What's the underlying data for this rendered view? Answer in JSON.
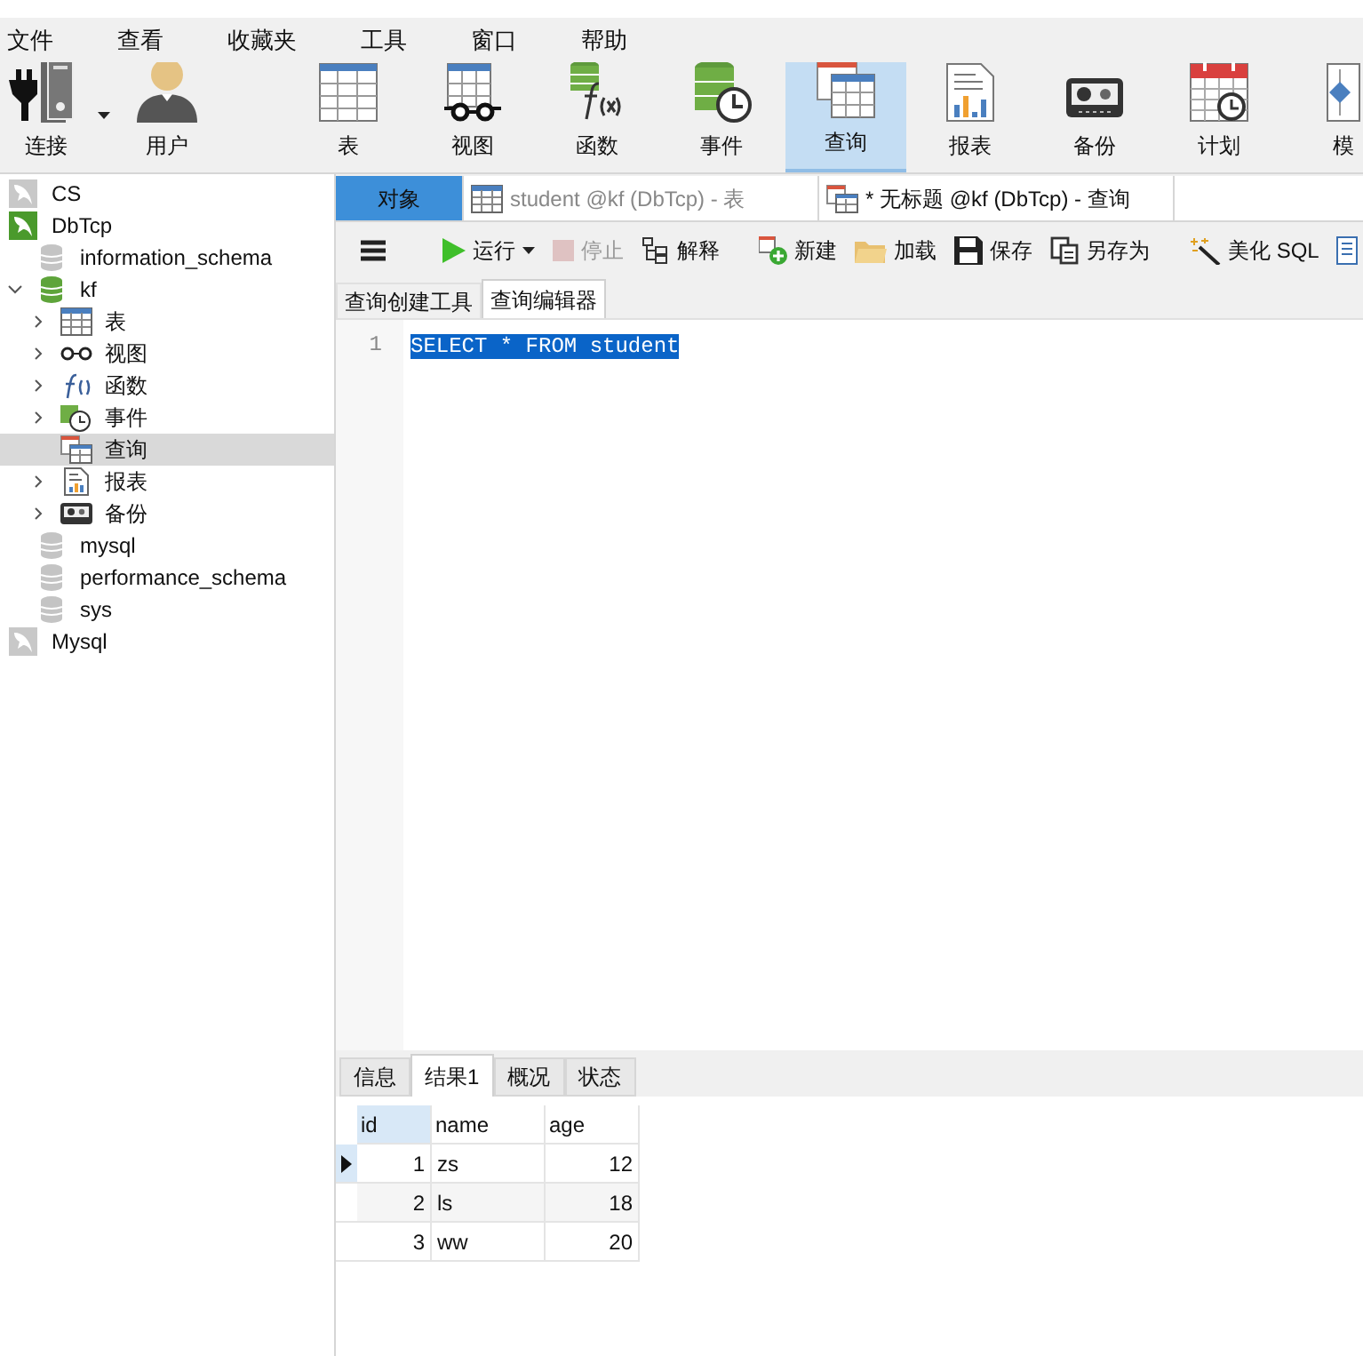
{
  "menu": [
    "文件",
    "查看",
    "收藏夹",
    "工具",
    "窗口",
    "帮助"
  ],
  "toolbar": [
    {
      "kind": "connect",
      "label": "连接",
      "selected": false,
      "dropdown": true
    },
    {
      "kind": "user",
      "label": "用户",
      "selected": false,
      "dropdown": false
    },
    {
      "kind": "separator"
    },
    {
      "kind": "table",
      "label": "表",
      "selected": false,
      "dropdown": false
    },
    {
      "kind": "view",
      "label": "视图",
      "selected": false,
      "dropdown": false
    },
    {
      "kind": "function",
      "label": "函数",
      "selected": false,
      "dropdown": false
    },
    {
      "kind": "event",
      "label": "事件",
      "selected": false,
      "dropdown": false
    },
    {
      "kind": "query",
      "label": "查询",
      "selected": true,
      "dropdown": false
    },
    {
      "kind": "report",
      "label": "报表",
      "selected": false,
      "dropdown": false
    },
    {
      "kind": "backup",
      "label": "备份",
      "selected": false,
      "dropdown": false
    },
    {
      "kind": "schedule",
      "label": "计划",
      "selected": false,
      "dropdown": false
    },
    {
      "kind": "model",
      "label": "模",
      "selected": false,
      "dropdown": false
    }
  ],
  "tree": [
    {
      "kind": "conn-off",
      "label": "CS",
      "selected": false
    },
    {
      "kind": "conn-on",
      "label": "DbTcp",
      "selected": false,
      "children": [
        {
          "kind": "db-off",
          "label": "information_schema",
          "selected": false
        },
        {
          "kind": "db-on",
          "label": "kf",
          "selected": false,
          "expanded": true,
          "children": [
            {
              "kind": "table",
              "label": "表",
              "selected": false,
              "expanded": false
            },
            {
              "kind": "view",
              "label": "视图",
              "selected": false,
              "expanded": false
            },
            {
              "kind": "function",
              "label": "函数",
              "selected": false,
              "expanded": false
            },
            {
              "kind": "event",
              "label": "事件",
              "selected": false,
              "expanded": false
            },
            {
              "kind": "query",
              "label": "查询",
              "selected": true
            },
            {
              "kind": "report",
              "label": "报表",
              "selected": false,
              "expanded": false
            },
            {
              "kind": "backup",
              "label": "备份",
              "selected": false,
              "expanded": false
            }
          ]
        },
        {
          "kind": "db-off",
          "label": "mysql",
          "selected": false
        },
        {
          "kind": "db-off",
          "label": "performance_schema",
          "selected": false
        },
        {
          "kind": "db-off",
          "label": "sys",
          "selected": false
        }
      ]
    },
    {
      "kind": "conn-off",
      "label": "Mysql",
      "selected": false
    }
  ],
  "doc_tabs": [
    {
      "kind": "objects",
      "label": "对象",
      "selected": false
    },
    {
      "kind": "table",
      "label": "student @kf (DbTcp) - 表",
      "selected": false
    },
    {
      "kind": "query",
      "label": "* 无标题 @kf (DbTcp) - 查询",
      "selected": true
    }
  ],
  "query_toolbar": [
    {
      "kind": "menu",
      "disabled": false
    },
    {
      "kind": "run",
      "label": "运行",
      "disabled": false
    },
    {
      "kind": "stop",
      "label": "停止",
      "disabled": true
    },
    {
      "kind": "explain",
      "label": "解释",
      "disabled": false
    },
    {
      "kind": "new",
      "label": "新建",
      "disabled": false
    },
    {
      "kind": "load",
      "label": "加载",
      "disabled": false
    },
    {
      "kind": "save",
      "label": "保存",
      "disabled": false
    },
    {
      "kind": "saveas",
      "label": "另存为",
      "disabled": false
    },
    {
      "kind": "beautify",
      "label": "美化 SQL",
      "disabled": false
    },
    {
      "kind": "more",
      "disabled": false
    }
  ],
  "editor_tabs": [
    {
      "label": "查询创建工具",
      "selected": false
    },
    {
      "label": "查询编辑器",
      "selected": true
    }
  ],
  "editor": {
    "lines": [
      {
        "number": "1",
        "text": "SELECT * FROM student",
        "selected": true
      }
    ]
  },
  "result_tabs": [
    {
      "label": "信息",
      "selected": false
    },
    {
      "label": "结果1",
      "selected": true
    },
    {
      "label": "概况",
      "selected": false
    },
    {
      "label": "状态",
      "selected": false
    }
  ],
  "result_table": {
    "columns": [
      {
        "label": "id",
        "selected": true
      },
      {
        "label": "name",
        "selected": false
      },
      {
        "label": "age",
        "selected": false
      }
    ],
    "rows": [
      {
        "selected": true,
        "cells": [
          "1",
          "zs",
          "12"
        ]
      },
      {
        "selected": false,
        "cells": [
          "2",
          "ls",
          "18"
        ]
      },
      {
        "selected": false,
        "cells": [
          "3",
          "ww",
          "20"
        ]
      }
    ]
  }
}
